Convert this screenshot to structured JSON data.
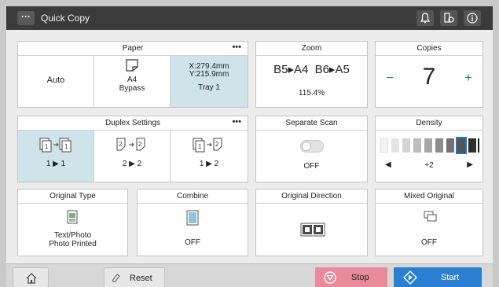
{
  "header": {
    "title": "Quick Copy",
    "menu_icon": "ellipsis-icon"
  },
  "paper": {
    "title": "Paper",
    "more": "•••",
    "auto": "Auto",
    "size": "A4",
    "source": "Bypass",
    "dim_x": "X:279.4mm",
    "dim_y": "Y:215.9mm",
    "tray": "Tray 1"
  },
  "zoom": {
    "title": "Zoom",
    "preset1": "B5▸A4",
    "preset2": "B6▸A5",
    "value": "115.4%"
  },
  "copies": {
    "title": "Copies",
    "minus": "−",
    "value": "7",
    "plus": "+"
  },
  "duplex": {
    "title": "Duplex Settings",
    "more": "•••",
    "options": [
      {
        "label": "1 ▶ 1"
      },
      {
        "label": "2 ▶ 2"
      },
      {
        "label": "1 ▶ 2"
      }
    ]
  },
  "separate_scan": {
    "title": "Separate Scan",
    "state": "OFF"
  },
  "density": {
    "title": "Density",
    "left": "◀",
    "right": "▶",
    "value": "+2"
  },
  "original_type": {
    "title": "Original Type",
    "line1": "Text/Photo",
    "line2": "Photo Printed"
  },
  "combine": {
    "title": "Combine",
    "state": "OFF"
  },
  "original_direction": {
    "title": "Original Direction"
  },
  "mixed_original": {
    "title": "Mixed Original",
    "state": "OFF"
  },
  "bottom": {
    "reset": "Reset",
    "stop": "Stop",
    "start": "Start"
  },
  "colors": {
    "accent": "#1e73c8",
    "stop": "#e88a9a",
    "start": "#2a7fd2",
    "selected": "#cfe3ea",
    "topbar": "#3b3b3b"
  }
}
